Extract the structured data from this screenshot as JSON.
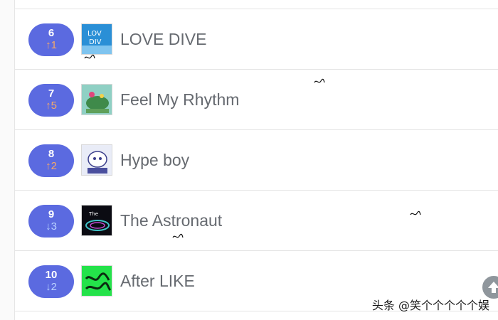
{
  "chart_list": {
    "items": [
      {
        "rank": "6",
        "change": "↑1",
        "direction": "up",
        "title": "LOVE DIVE",
        "cover_icon": "love-dive-cover-icon"
      },
      {
        "rank": "7",
        "change": "↑5",
        "direction": "up",
        "title": "Feel My Rhythm",
        "cover_icon": "feel-my-rhythm-cover-icon"
      },
      {
        "rank": "8",
        "change": "↑2",
        "direction": "up",
        "title": "Hype boy",
        "cover_icon": "hype-boy-cover-icon"
      },
      {
        "rank": "9",
        "change": "↓3",
        "direction": "down",
        "title": "The Astronaut",
        "cover_icon": "the-astronaut-cover-icon"
      },
      {
        "rank": "10",
        "change": "↓2",
        "direction": "down",
        "title": "After LIKE",
        "cover_icon": "after-like-cover-icon"
      }
    ]
  },
  "colors": {
    "rank_pill": "#5b6ae0",
    "rank_up": "#f4a86a",
    "rank_down": "#b9d2ff",
    "title_text": "#666a70"
  },
  "watermark": {
    "text": "头条 @笑个个个个个娱"
  },
  "scroll_top": {
    "icon": "arrow-up-icon"
  }
}
